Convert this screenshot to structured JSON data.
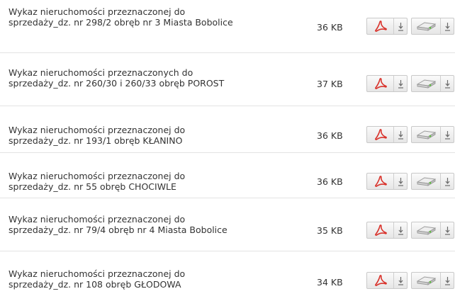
{
  "documents": [
    {
      "title": "Wykaz nieruchomości przeznaczonej do sprzedaży_dz. nr 298/2 obręb nr 3 Miasta Bobolice",
      "size": "36 KB"
    },
    {
      "title": "Wykaz nieruchomości przeznaczonych do sprzedaży_dz. nr 260/30 i 260/33 obręb POROST",
      "size": "37 KB"
    },
    {
      "title": "Wykaz nieruchomości przeznaczonej do sprzedaży_dz. nr 193/1 obręb KŁANINO",
      "size": "36 KB"
    },
    {
      "title": "Wykaz nieruchomości przeznaczonej do sprzedaży_dz. nr 55 obręb CHOCIWLE",
      "size": "36 KB"
    },
    {
      "title": "Wykaz nieruchomości przeznaczonej do sprzedaży_dz. nr 79/4 obręb nr 4 Miasta Bobolice",
      "size": "35 KB"
    },
    {
      "title": "Wykaz nieruchomości przeznaczonej do sprzedaży_dz. nr 108 obręb GŁODOWA",
      "size": "34 KB"
    }
  ],
  "icons": {
    "pdf": "pdf-icon",
    "download": "download-arrow-icon",
    "disk": "disk-icon"
  },
  "colors": {
    "pdf_red": "#d9322b",
    "disk_green": "#5bbf3a",
    "row_border": "#e3e3e3"
  }
}
